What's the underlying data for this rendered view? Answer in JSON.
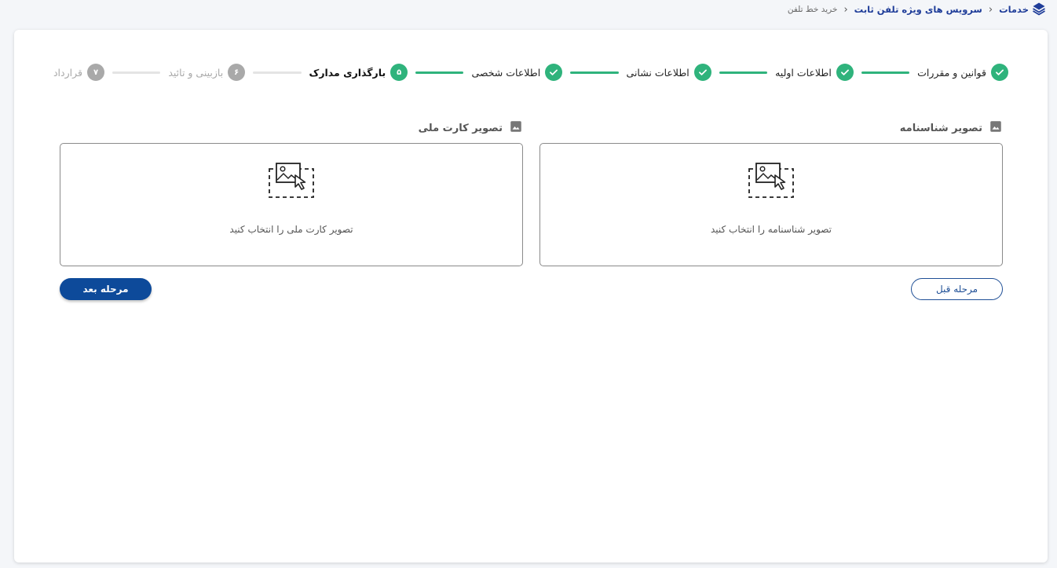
{
  "breadcrumb": {
    "home": "خدمات",
    "section": "سرویس های ویژه تلفن ثابت",
    "current": "خرید خط تلفن"
  },
  "steps": [
    {
      "label": "قوانین و مقررات",
      "status": "done"
    },
    {
      "label": "اطلاعات اولیه",
      "status": "done"
    },
    {
      "label": "اطلاعات نشانی",
      "status": "done"
    },
    {
      "label": "اطلاعات شخصی",
      "status": "done"
    },
    {
      "label": "بارگذاری مدارک",
      "status": "active",
      "number": "۵"
    },
    {
      "label": "بازبینی و تائید",
      "status": "pending",
      "number": "۶"
    },
    {
      "label": "قرارداد",
      "status": "pending",
      "number": "۷"
    }
  ],
  "uploads": {
    "birth_certificate": {
      "title": "تصویر شناسنامه",
      "prompt": "تصویر شناسنامه را انتخاب کنید"
    },
    "national_card": {
      "title": "تصویر کارت ملی",
      "prompt": "تصویر کارت ملی را انتخاب کنید"
    }
  },
  "buttons": {
    "prev_label": "مرحله قبل",
    "next_label": "مرحله بعد"
  },
  "colors": {
    "accent": "#0d4a9a",
    "success": "#2fb37c",
    "pending": "#a9a9a9",
    "link": "#1f3d99"
  }
}
